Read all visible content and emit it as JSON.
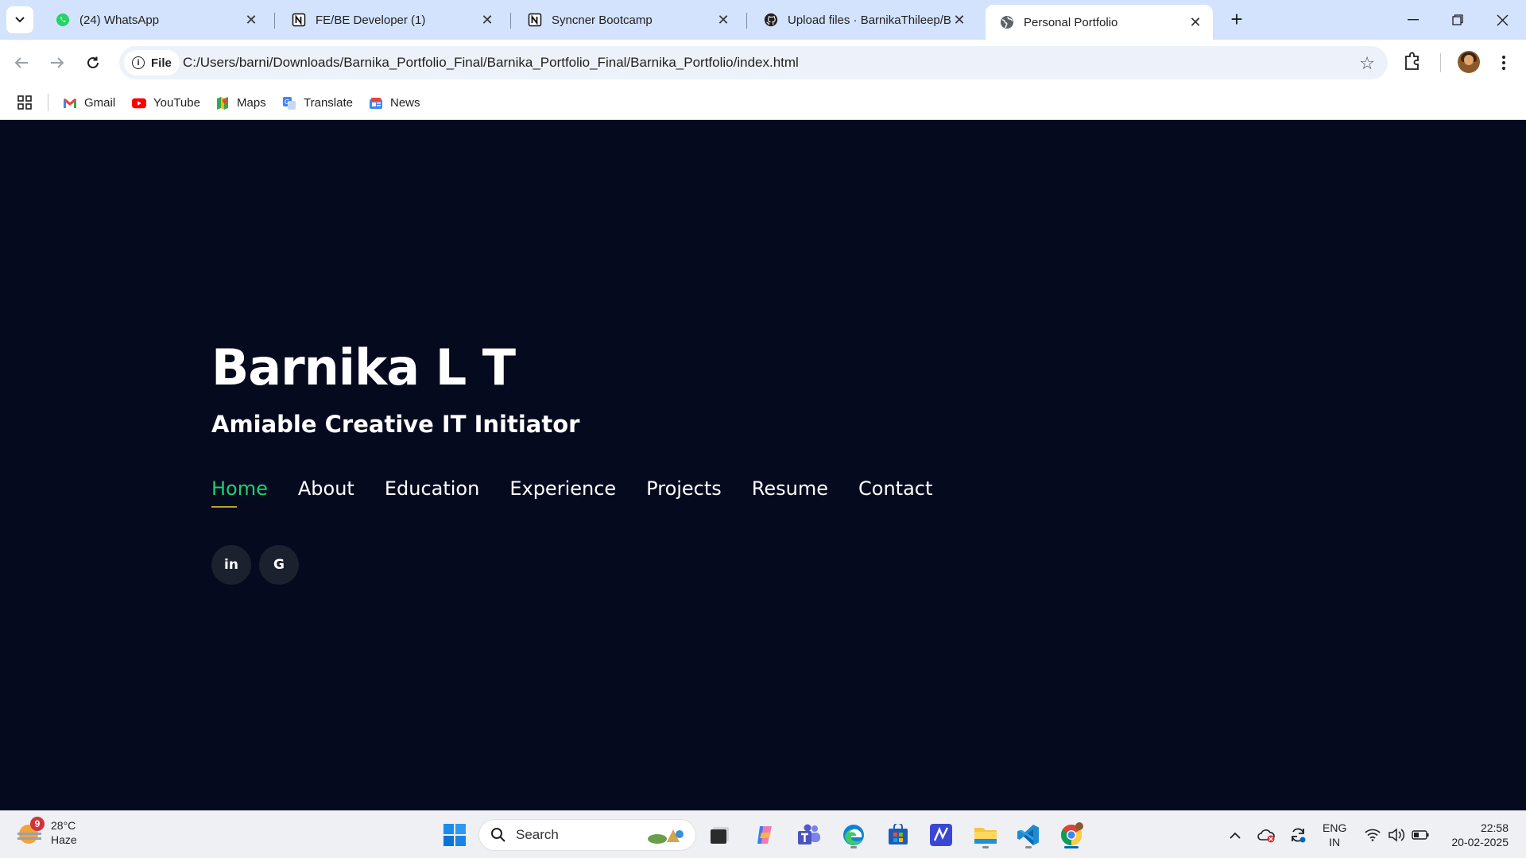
{
  "browser": {
    "tabs": [
      {
        "title": "(24) WhatsApp",
        "icon": "whatsapp-icon"
      },
      {
        "title": "FE/BE Developer (1)",
        "icon": "notion-icon"
      },
      {
        "title": "Syncner Bootcamp",
        "icon": "notion-icon"
      },
      {
        "title": "Upload files · BarnikaThileep/Bo",
        "icon": "github-icon"
      },
      {
        "title": "Personal Portfolio",
        "icon": "globe-icon",
        "active": true
      }
    ],
    "address": {
      "chip_label": "File",
      "url": "C:/Users/barni/Downloads/Barnika_Portfolio_Final/Barnika_Portfolio_Final/Barnika_Portfolio/index.html"
    },
    "bookmarks": [
      {
        "label": "Gmail",
        "icon": "gmail-icon"
      },
      {
        "label": "YouTube",
        "icon": "youtube-icon"
      },
      {
        "label": "Maps",
        "icon": "maps-icon"
      },
      {
        "label": "Translate",
        "icon": "translate-icon"
      },
      {
        "label": "News",
        "icon": "news-icon"
      }
    ]
  },
  "page": {
    "name": "Barnika L T",
    "tagline": "Amiable Creative IT Initiator",
    "nav": [
      {
        "label": "Home",
        "active": true
      },
      {
        "label": "About"
      },
      {
        "label": "Education"
      },
      {
        "label": "Experience"
      },
      {
        "label": "Projects"
      },
      {
        "label": "Resume"
      },
      {
        "label": "Contact"
      }
    ],
    "social": [
      {
        "label": "in",
        "icon": "linkedin-icon"
      },
      {
        "label": "G",
        "icon": "google-icon"
      }
    ],
    "colors": {
      "background": "#050a1e",
      "accent": "#18d26e",
      "underline": "#b8a32a"
    }
  },
  "taskbar": {
    "weather": {
      "temp": "28°C",
      "condition": "Haze",
      "badge": "9"
    },
    "search_placeholder": "Search",
    "language": {
      "line1": "ENG",
      "line2": "IN"
    },
    "clock": {
      "time": "22:58",
      "date": "20-02-2025"
    }
  }
}
